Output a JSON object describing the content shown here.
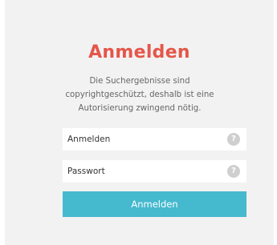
{
  "login": {
    "title": "Anmelden",
    "subtitle": "Die Suchergebnisse sind copyrightgeschützt, deshalb ist eine Autorisierung zwingend nötig.",
    "fields": [
      {
        "label": "Anmelden",
        "help_icon": "question-mark",
        "help_glyph": "?"
      },
      {
        "label": "Passwort",
        "help_icon": "question-mark",
        "help_glyph": "?"
      }
    ],
    "submit_label": "Anmelden"
  },
  "colors": {
    "title": "#e5564a",
    "button": "#45b9ce",
    "background": "#f2f2f2"
  }
}
